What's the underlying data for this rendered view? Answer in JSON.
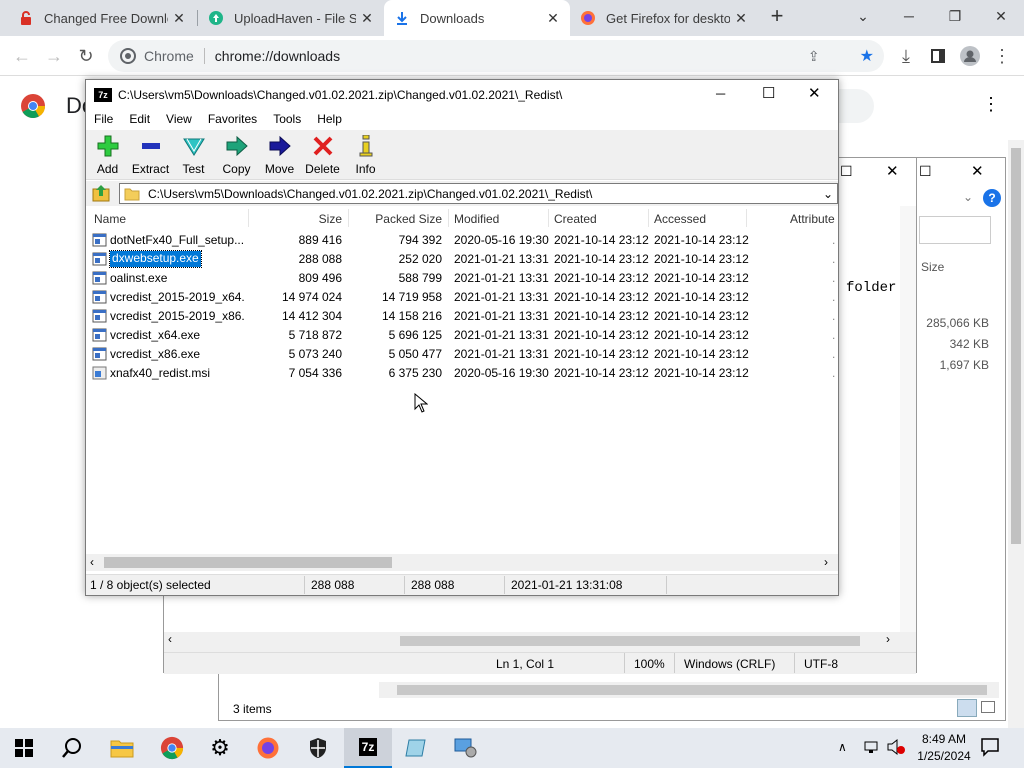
{
  "chrome": {
    "tabs": [
      {
        "title": "Changed Free Downlo",
        "icon": "lock-icon"
      },
      {
        "title": "UploadHaven - File Sh",
        "icon": "uploadhaven-icon"
      },
      {
        "title": "Downloads",
        "icon": "download-icon"
      },
      {
        "title": "Get Firefox for desktop",
        "icon": "firefox-icon"
      }
    ],
    "omnibox": {
      "site": "Chrome",
      "url": "chrome://downloads"
    },
    "page_partial_title": "Do"
  },
  "zip": {
    "title": "C:\\Users\\vm5\\Downloads\\Changed.v01.02.2021.zip\\Changed.v01.02.2021\\_Redist\\",
    "menu": [
      "File",
      "Edit",
      "View",
      "Favorites",
      "Tools",
      "Help"
    ],
    "tools": [
      {
        "label": "Add",
        "icon": "add-icon"
      },
      {
        "label": "Extract",
        "icon": "extract-icon"
      },
      {
        "label": "Test",
        "icon": "test-icon"
      },
      {
        "label": "Copy",
        "icon": "copy-icon"
      },
      {
        "label": "Move",
        "icon": "move-icon"
      },
      {
        "label": "Delete",
        "icon": "delete-icon"
      },
      {
        "label": "Info",
        "icon": "info-icon"
      }
    ],
    "address": "C:\\Users\\vm5\\Downloads\\Changed.v01.02.2021.zip\\Changed.v01.02.2021\\_Redist\\",
    "columns": [
      "Name",
      "Size",
      "Packed Size",
      "Modified",
      "Created",
      "Accessed",
      "Attribute"
    ],
    "files": [
      {
        "name": "dotNetFx40_Full_setup....",
        "size": "889 416",
        "packed": "794 392",
        "modified": "2020-05-16 19:30",
        "created": "2021-10-14 23:12",
        "accessed": "2021-10-14 23:12",
        "selected": false
      },
      {
        "name": "dxwebsetup.exe",
        "size": "288 088",
        "packed": "252 020",
        "modified": "2021-01-21 13:31",
        "created": "2021-10-14 23:12",
        "accessed": "2021-10-14 23:12",
        "selected": true
      },
      {
        "name": "oalinst.exe",
        "size": "809 496",
        "packed": "588 799",
        "modified": "2021-01-21 13:31",
        "created": "2021-10-14 23:12",
        "accessed": "2021-10-14 23:12",
        "selected": false
      },
      {
        "name": "vcredist_2015-2019_x64....",
        "size": "14 974 024",
        "packed": "14 719 958",
        "modified": "2021-01-21 13:31",
        "created": "2021-10-14 23:12",
        "accessed": "2021-10-14 23:12",
        "selected": false
      },
      {
        "name": "vcredist_2015-2019_x86....",
        "size": "14 412 304",
        "packed": "14 158 216",
        "modified": "2021-01-21 13:31",
        "created": "2021-10-14 23:12",
        "accessed": "2021-10-14 23:12",
        "selected": false
      },
      {
        "name": "vcredist_x64.exe",
        "size": "5 718 872",
        "packed": "5 696 125",
        "modified": "2021-01-21 13:31",
        "created": "2021-10-14 23:12",
        "accessed": "2021-10-14 23:12",
        "selected": false
      },
      {
        "name": "vcredist_x86.exe",
        "size": "5 073 240",
        "packed": "5 050 477",
        "modified": "2021-01-21 13:31",
        "created": "2021-10-14 23:12",
        "accessed": "2021-10-14 23:12",
        "selected": false
      },
      {
        "name": "xnafx40_redist.msi",
        "size": "7 054 336",
        "packed": "6 375 230",
        "modified": "2020-05-16 19:30",
        "created": "2021-10-14 23:12",
        "accessed": "2021-10-14 23:12",
        "selected": false
      }
    ],
    "status": {
      "selection": "1 / 8 object(s) selected",
      "size": "288 088",
      "packed": "288 088",
      "modified": "2021-01-21 13:31:08"
    }
  },
  "notepad": {
    "visible_text": "folder",
    "status": {
      "position": "Ln 1, Col 1",
      "zoom": "100%",
      "eol": "Windows (CRLF)",
      "encoding": "UTF-8"
    }
  },
  "explorer": {
    "size_header": "Size",
    "sizes": [
      "285,066 KB",
      "342 KB",
      "1,697 KB"
    ],
    "item_count": "3 items"
  },
  "taskbar": {
    "time": "8:49 AM",
    "date": "1/25/2024"
  }
}
